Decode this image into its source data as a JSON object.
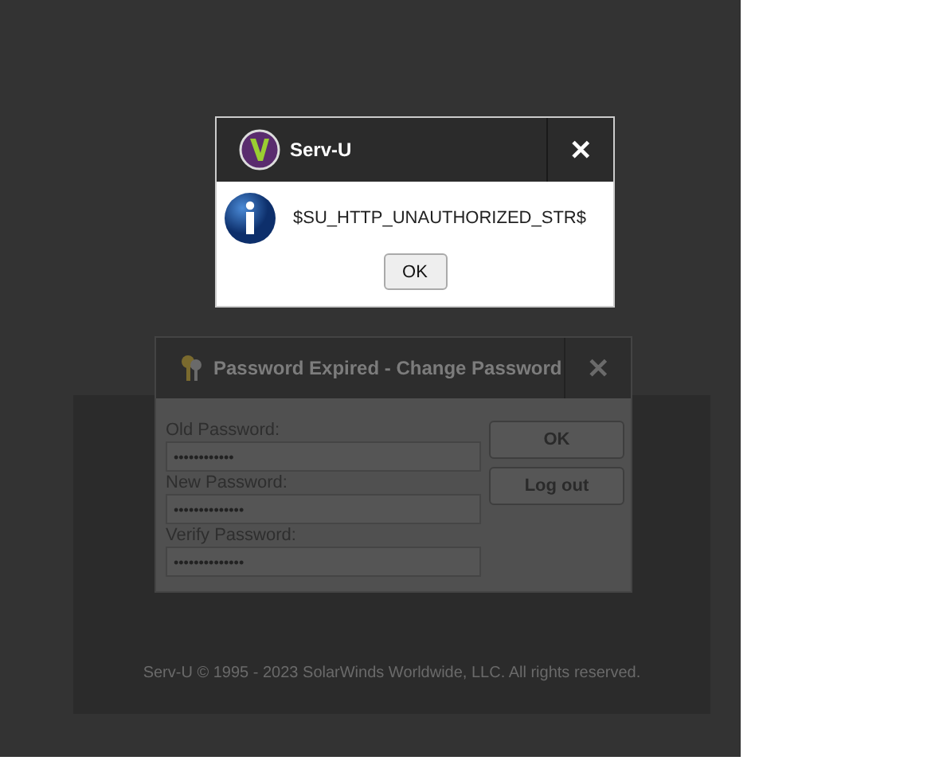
{
  "background": {
    "copyright": "Serv-U © 1995 - 2023 SolarWinds Worldwide, LLC. All rights reserved."
  },
  "alert": {
    "title": "Serv-U",
    "close": "✕",
    "message": "$SU_HTTP_UNAUTHORIZED_STR$",
    "button": "OK"
  },
  "password_dialog": {
    "title": "Password Expired - Change Password",
    "close": "✕",
    "fields": [
      {
        "label": "Old Password:",
        "value": "••••••••••••"
      },
      {
        "label": "New Password:",
        "value": "••••••••••••••"
      },
      {
        "label": "Verify Password:",
        "value": "••••••••••••••"
      }
    ],
    "buttons": [
      "OK",
      "Log out"
    ]
  }
}
